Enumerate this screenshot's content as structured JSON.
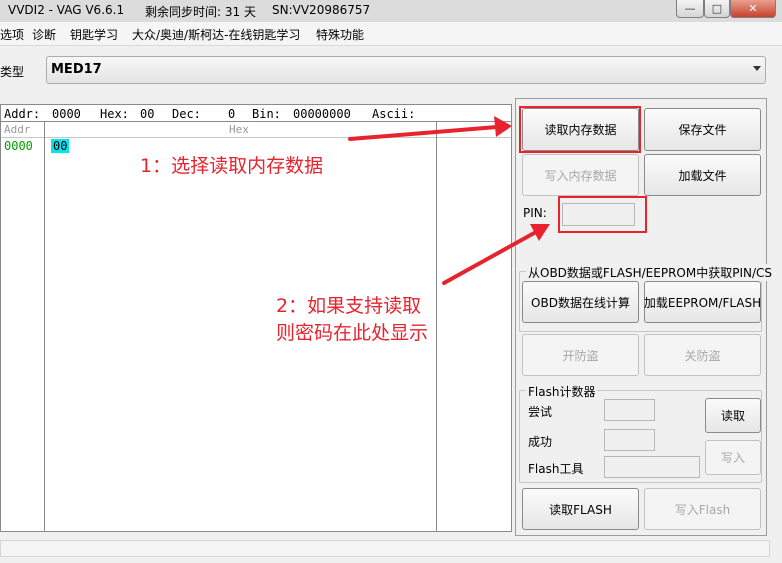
{
  "window": {
    "title": "VVDI2 - VAG V6.6.1",
    "sync_time": "剩余同步时间: 31 天",
    "serial": "SN:VV20986757",
    "min_glyph": "—",
    "max_glyph": "□",
    "close_glyph": "✕"
  },
  "menu": [
    "选项",
    "诊断",
    "钥匙学习",
    "大众/奥迪/斯柯达-在线钥匙学习",
    "特殊功能"
  ],
  "type_row": {
    "label": "类型",
    "value": "MED17"
  },
  "hex": {
    "header": {
      "addr_label": "Addr:",
      "addr": "0000",
      "hex_label": "Hex:",
      "hex": "00",
      "dec_label": "Dec:",
      "dec": "0",
      "bin_label": "Bin:",
      "bin": "00000000",
      "ascii_label": "Ascii:"
    },
    "col_addr": "Addr",
    "col_hex": "Hex",
    "rows": [
      {
        "addr": "0000",
        "first_byte": "00"
      }
    ]
  },
  "buttons": {
    "read_memory": "读取内存数据",
    "save_file": "保存文件",
    "write_memory": "写入内存数据",
    "load_file": "加载文件",
    "obd_calc": "OBD数据在线计算",
    "load_eeprom": "加载EEPROM/FLASH",
    "immo_on": "开防盗",
    "immo_off": "关防盗",
    "read": "读取",
    "write": "写入",
    "read_flash": "读取FLASH",
    "write_flash": "写入Flash"
  },
  "pin": {
    "label": "PIN:",
    "value": ""
  },
  "obd_group": {
    "title": "从OBD数据或FLASH/EEPROM中获取PIN/CS"
  },
  "flash_counter": {
    "title": "Flash计数器",
    "try_label": "尝试",
    "success_label": "成功",
    "tool_label": "Flash工具",
    "try_value": "",
    "success_value": "",
    "tool_value": ""
  },
  "annotations": {
    "step1": "1：选择读取内存数据",
    "step2_line1": "2：如果支持读取",
    "step2_line2": "则密码在此处显示"
  },
  "colors": {
    "annotation_red": "#e8232e",
    "address_green": "#00a000",
    "selected_byte_bg": "#00e5ee"
  }
}
